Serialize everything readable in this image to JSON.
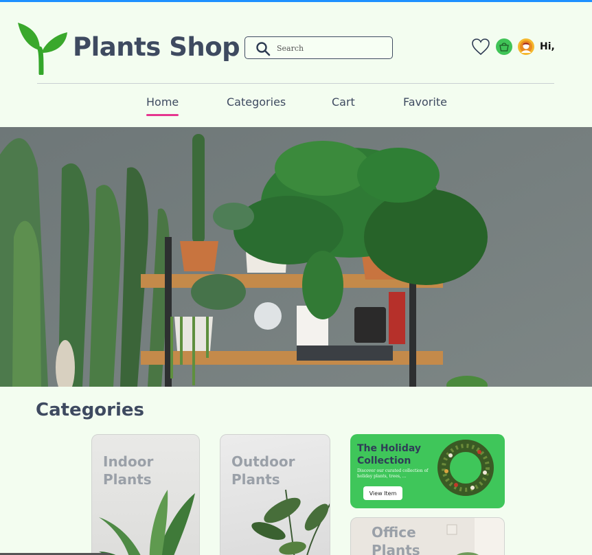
{
  "brand": {
    "name": "Plants Shop"
  },
  "search": {
    "placeholder": "Search"
  },
  "user": {
    "greeting": "Hi,"
  },
  "nav": {
    "items": [
      "Home",
      "Categories",
      "Cart",
      "Favorite"
    ],
    "active": "Home"
  },
  "categories": {
    "title": "Categories",
    "cards": [
      {
        "label": "Indoor Plants"
      },
      {
        "label": "Outdoor Plants"
      },
      {
        "label": "Office Plants"
      }
    ],
    "promo": {
      "title": "The Holiday Collection",
      "description": "Discover our curated collection of holiday plants, trees, ...",
      "button": "View Item"
    }
  },
  "colors": {
    "brand_text": "#3e4a60",
    "leaf_green": "#3fc65a",
    "nav_active_underline": "#e5358f",
    "page_bg": "#f3fdf0"
  },
  "icons": [
    "leaf-logo-icon",
    "search-icon",
    "heart-icon",
    "basket-icon",
    "avatar"
  ]
}
